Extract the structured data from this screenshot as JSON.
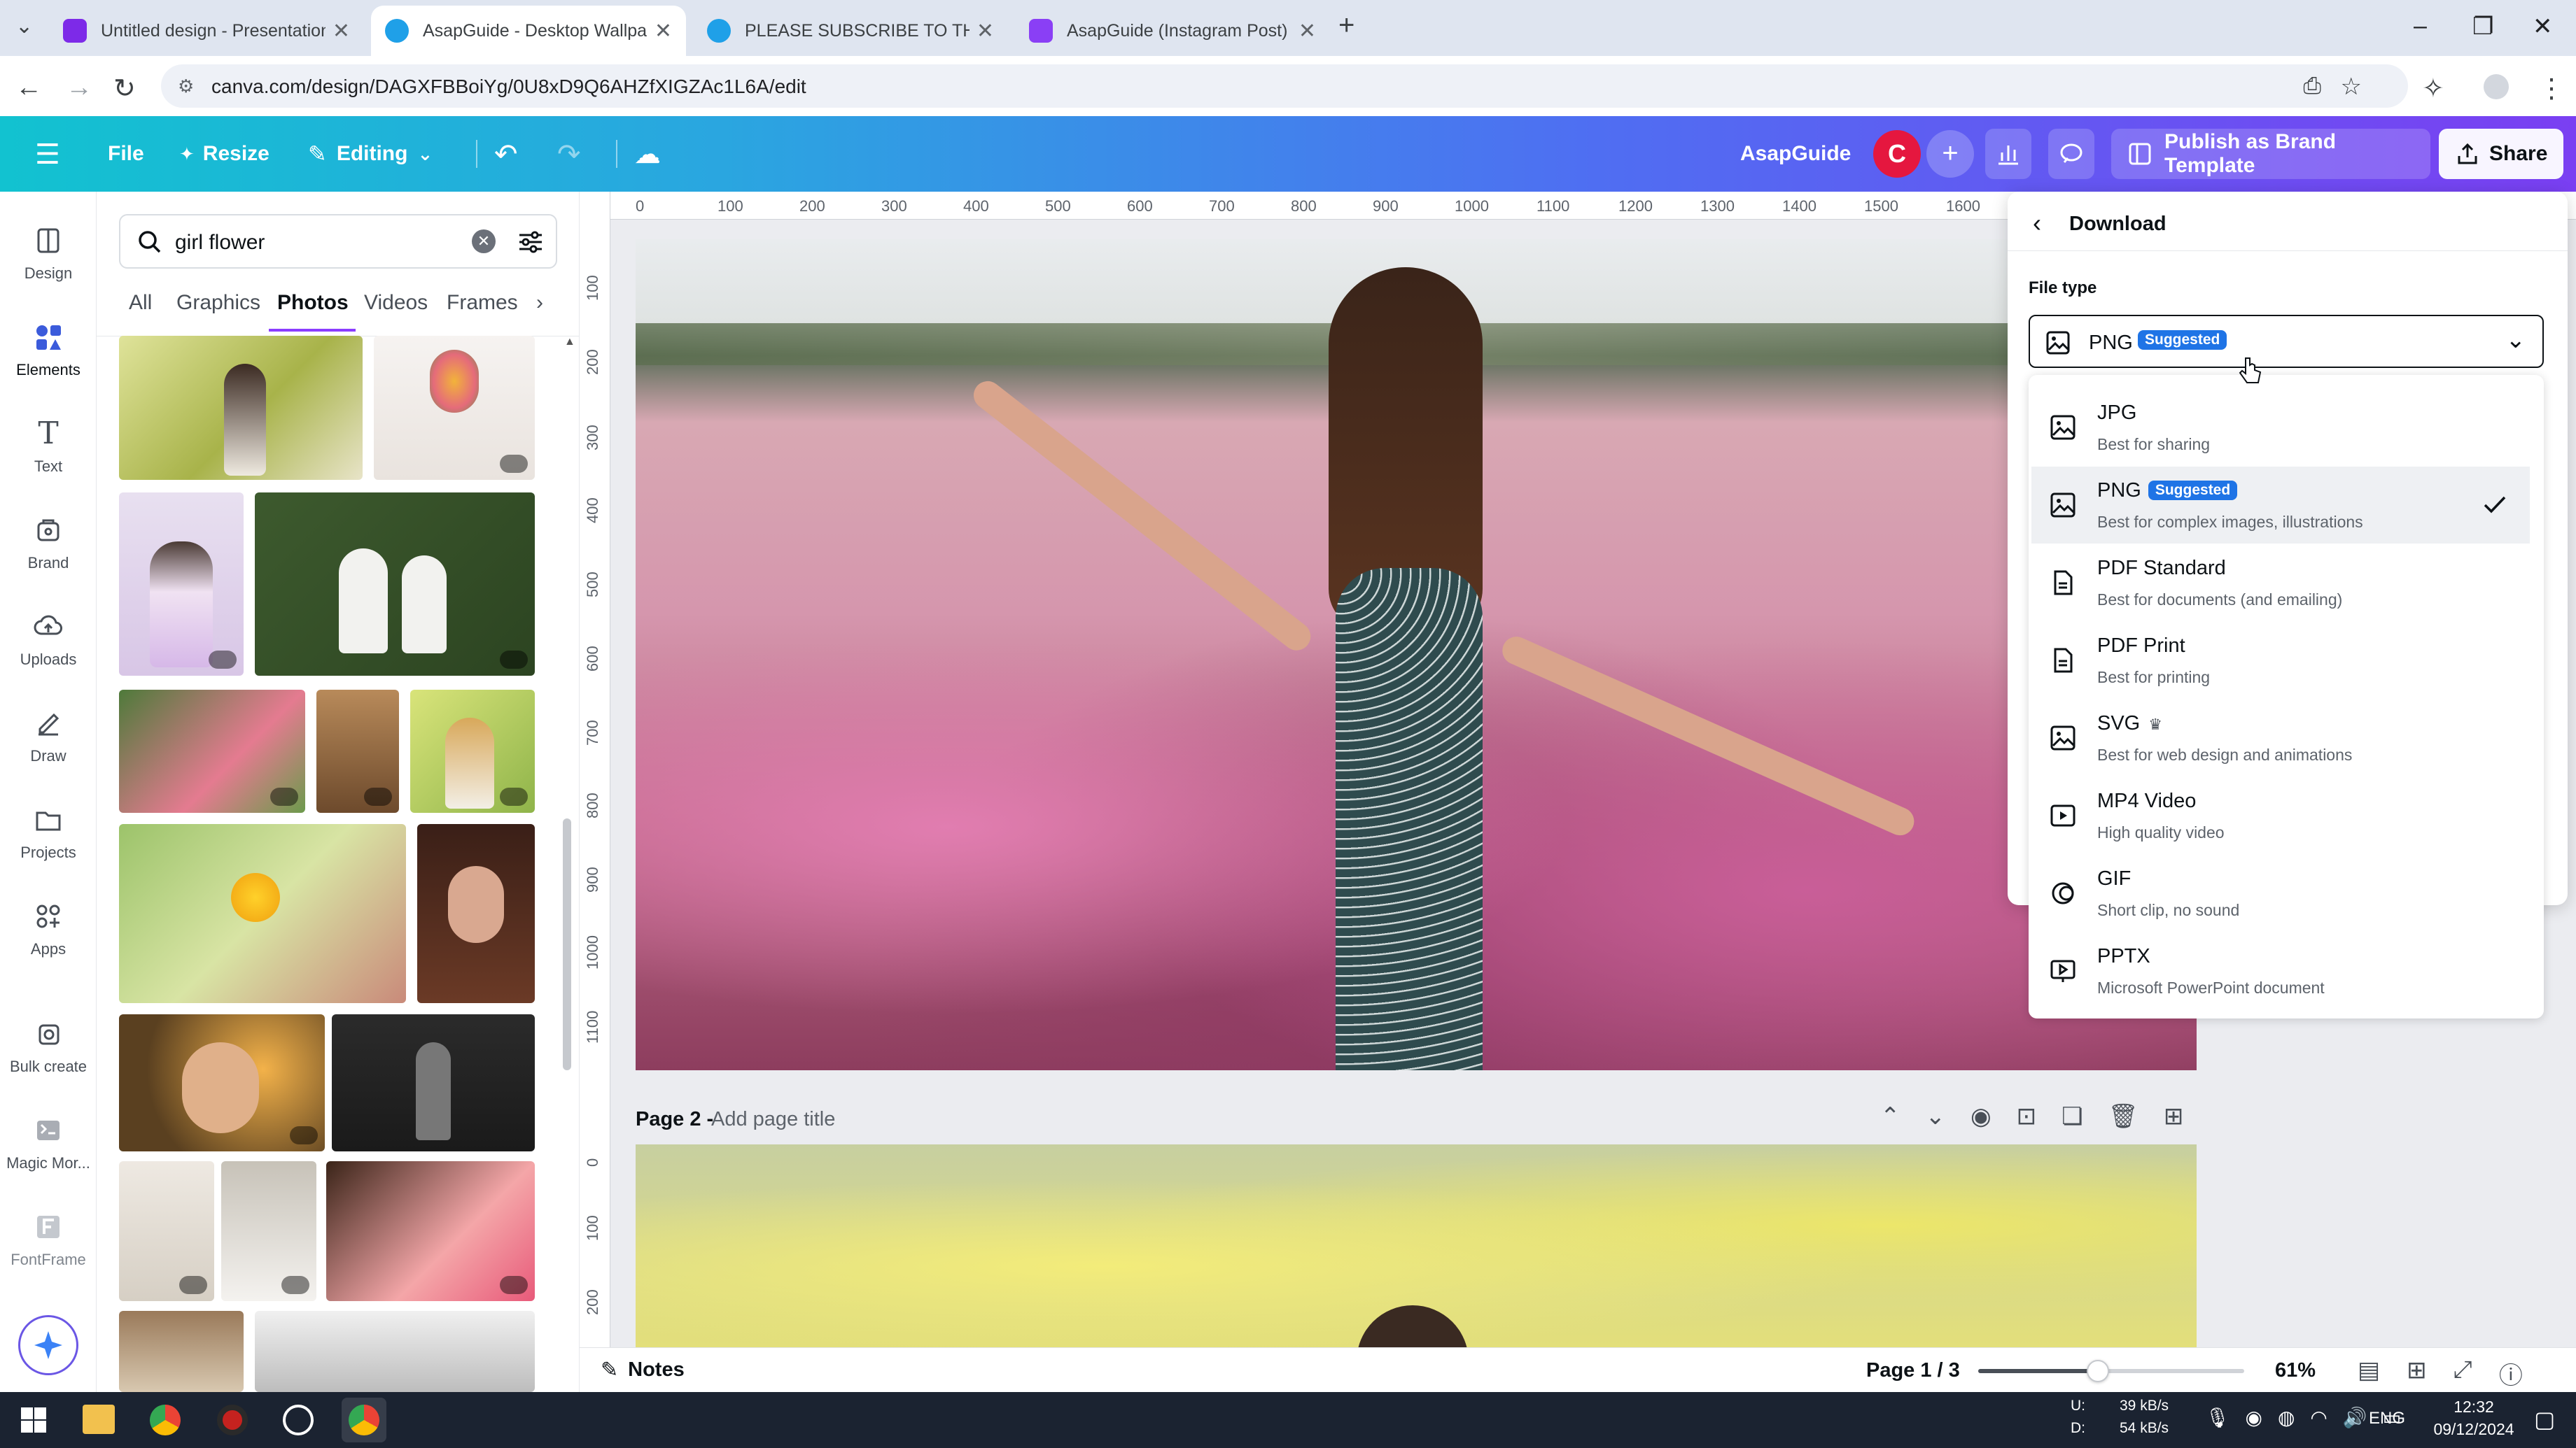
{
  "browser": {
    "tabs": [
      {
        "title": "Untitled design - Presentation",
        "active": false,
        "color": "#7d2ae8"
      },
      {
        "title": "AsapGuide - Desktop Wallpape",
        "active": true,
        "color": "#1fa0e8"
      },
      {
        "title": "PLEASE SUBSCRIBE TO THIS CH",
        "active": false,
        "color": "#1fa0e8"
      },
      {
        "title": "AsapGuide (Instagram Post) - Y",
        "active": false,
        "color": "#8a3ff5"
      }
    ],
    "url": "canva.com/design/DAGXFBBoiYg/0U8xD9Q6AHZfXIGZAc1L6A/edit"
  },
  "topbar": {
    "file": "File",
    "resize": "Resize",
    "editing": "Editing",
    "brand_name": "AsapGuide",
    "avatar_letter": "C",
    "publish": "Publish as Brand Template",
    "share": "Share"
  },
  "rail": [
    {
      "label": "Design",
      "icon": "design-icon"
    },
    {
      "label": "Elements",
      "icon": "elements-icon"
    },
    {
      "label": "Text",
      "icon": "text-icon"
    },
    {
      "label": "Brand",
      "icon": "brand-icon"
    },
    {
      "label": "Uploads",
      "icon": "uploads-icon"
    },
    {
      "label": "Draw",
      "icon": "draw-icon"
    },
    {
      "label": "Projects",
      "icon": "projects-icon"
    },
    {
      "label": "Apps",
      "icon": "apps-icon"
    },
    {
      "label": "Bulk create",
      "icon": "bulk-create-icon"
    },
    {
      "label": "Magic Mor...",
      "icon": "magic-morph-icon"
    },
    {
      "label": "FontFrame",
      "icon": "fontframe-icon"
    }
  ],
  "panel": {
    "search_value": "girl flower",
    "tabs": [
      "All",
      "Graphics",
      "Photos",
      "Videos",
      "Frames"
    ],
    "active_tab": "Photos"
  },
  "ruler": {
    "h": [
      "0",
      "100",
      "200",
      "300",
      "400",
      "500",
      "600",
      "700",
      "800",
      "900",
      "1000",
      "1100",
      "1200",
      "1300",
      "1400",
      "1500",
      "1600"
    ],
    "v": [
      "100",
      "200",
      "300",
      "400",
      "500",
      "600",
      "700",
      "800",
      "900",
      "1000",
      "1100",
      "0",
      "100",
      "200"
    ]
  },
  "page2": {
    "label": "Page 2 -",
    "placeholder": "Add page title"
  },
  "footer": {
    "notes": "Notes",
    "page": "Page 1 / 3",
    "zoom": "61%",
    "zoom_fraction": 0.45
  },
  "download": {
    "title": "Download",
    "file_type_label": "File type",
    "selected": "PNG",
    "suggested_badge": "Suggested",
    "options": [
      {
        "name": "JPG",
        "desc": "Best for sharing",
        "icon": "image-icon"
      },
      {
        "name": "PNG",
        "desc": "Best for complex images, illustrations",
        "icon": "image-icon",
        "badge": "Suggested",
        "selected": true
      },
      {
        "name": "PDF Standard",
        "desc": "Best for documents (and emailing)",
        "icon": "document-icon"
      },
      {
        "name": "PDF Print",
        "desc": "Best for printing",
        "icon": "document-icon"
      },
      {
        "name": "SVG",
        "desc": "Best for web design and animations",
        "icon": "image-icon",
        "premium": true
      },
      {
        "name": "MP4 Video",
        "desc": "High quality video",
        "icon": "video-icon"
      },
      {
        "name": "GIF",
        "desc": "Short clip, no sound",
        "icon": "gif-icon"
      },
      {
        "name": "PPTX",
        "desc": "Microsoft PowerPoint document",
        "icon": "presentation-icon"
      }
    ]
  },
  "taskbar": {
    "net_up_label": "U:",
    "net_down_label": "D:",
    "net_up": "39 kB/s",
    "net_down": "54 kB/s",
    "lang": "ENG",
    "time": "12:32",
    "date": "09/12/2024"
  }
}
